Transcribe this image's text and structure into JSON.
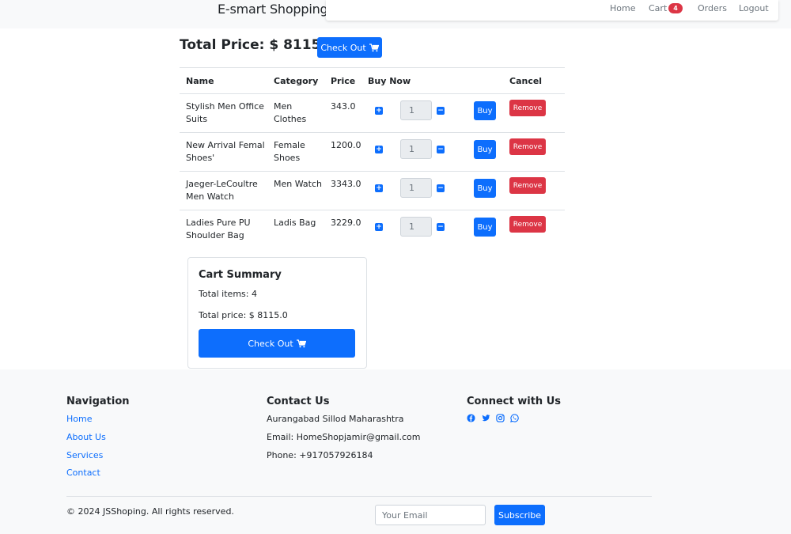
{
  "navbar": {
    "brand": "E-smart Shopping",
    "links": {
      "home": "Home",
      "cart": "Cart",
      "orders": "Orders",
      "logout": "Logout"
    },
    "cart_count": "4"
  },
  "header": {
    "total_price": "Total Price: $ 8115.0",
    "checkout_label": "Check Out"
  },
  "table": {
    "columns": [
      "Name",
      "Category",
      "Price",
      "Buy Now",
      "Cancel"
    ],
    "rows": [
      {
        "name_line1": "Stylish Men Office",
        "name_line2": "Suits",
        "category_line1": "Men",
        "category_line2": "Clothes",
        "price": "343.0",
        "qty": "1"
      },
      {
        "name_line1": "New Arrival Femal",
        "name_line2": "Shoes'",
        "category_line1": "Female",
        "category_line2": "Shoes",
        "price": "1200.0",
        "qty": "1"
      },
      {
        "name_line1": "Jaeger-LeCoultre",
        "name_line2": "Men Watch",
        "category_line1": "Men Watch",
        "category_line2": "",
        "price": "3343.0",
        "qty": "1"
      },
      {
        "name_line1": "Ladies Pure PU",
        "name_line2": "Shoulder Bag",
        "category_line1": "Ladis Bag",
        "category_line2": "",
        "price": "3229.0",
        "qty": "1"
      }
    ],
    "buy_label": "Buy",
    "remove_label": "Remove"
  },
  "summary": {
    "title": "Cart Summary",
    "total_items": "Total items: 4",
    "total_price": "Total price: $ 8115.0",
    "checkout_label": "Check Out"
  },
  "footer": {
    "navigation": {
      "heading": "Navigation",
      "links": [
        "Home",
        "About Us",
        "Services",
        "Contact"
      ]
    },
    "contact": {
      "heading": "Contact Us",
      "address": "Aurangabad Sillod Maharashtra",
      "email": "Email: HomeShopjamir@gmail.com",
      "phone": "Phone: +917057926184"
    },
    "connect": {
      "heading": "Connect with Us",
      "icons": [
        "facebook-icon",
        "twitter-icon",
        "instagram-icon",
        "whatsapp-icon"
      ]
    },
    "copyright": "© 2024 JSShoping. All rights reserved.",
    "email_placeholder": "Your Email",
    "subscribe_label": "Subscribe"
  },
  "colors": {
    "primary": "#0d6efd",
    "danger": "#dc3545",
    "footer_bg": "#f8f9fa"
  }
}
